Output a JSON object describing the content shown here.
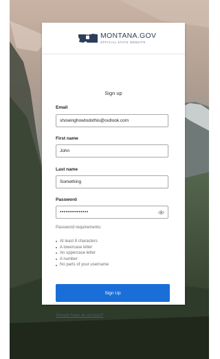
{
  "brand": {
    "name": "MONTANA.GOV",
    "tagline": "OFFICIAL STATE WEBSITE"
  },
  "form": {
    "title": "Sign up",
    "email": {
      "label": "Email",
      "value": "showinghowtodothis@outlook.com"
    },
    "first_name": {
      "label": "First name",
      "value": "John"
    },
    "last_name": {
      "label": "Last name",
      "value": "Something"
    },
    "password": {
      "label": "Password",
      "value": "•••••••••••••••"
    },
    "requirements_title": "Password requirements:",
    "requirements": [
      "At least 8 characters",
      "A lowercase letter",
      "An uppercase letter",
      "A number",
      "No parts of your username"
    ],
    "submit_label": "Sign Up",
    "login_link": "Already have an account?"
  },
  "colors": {
    "primary_button": "#1a6ed8",
    "brand_text": "#2d3e5c"
  },
  "icons": [
    "montana-state-icon",
    "eye-icon"
  ]
}
